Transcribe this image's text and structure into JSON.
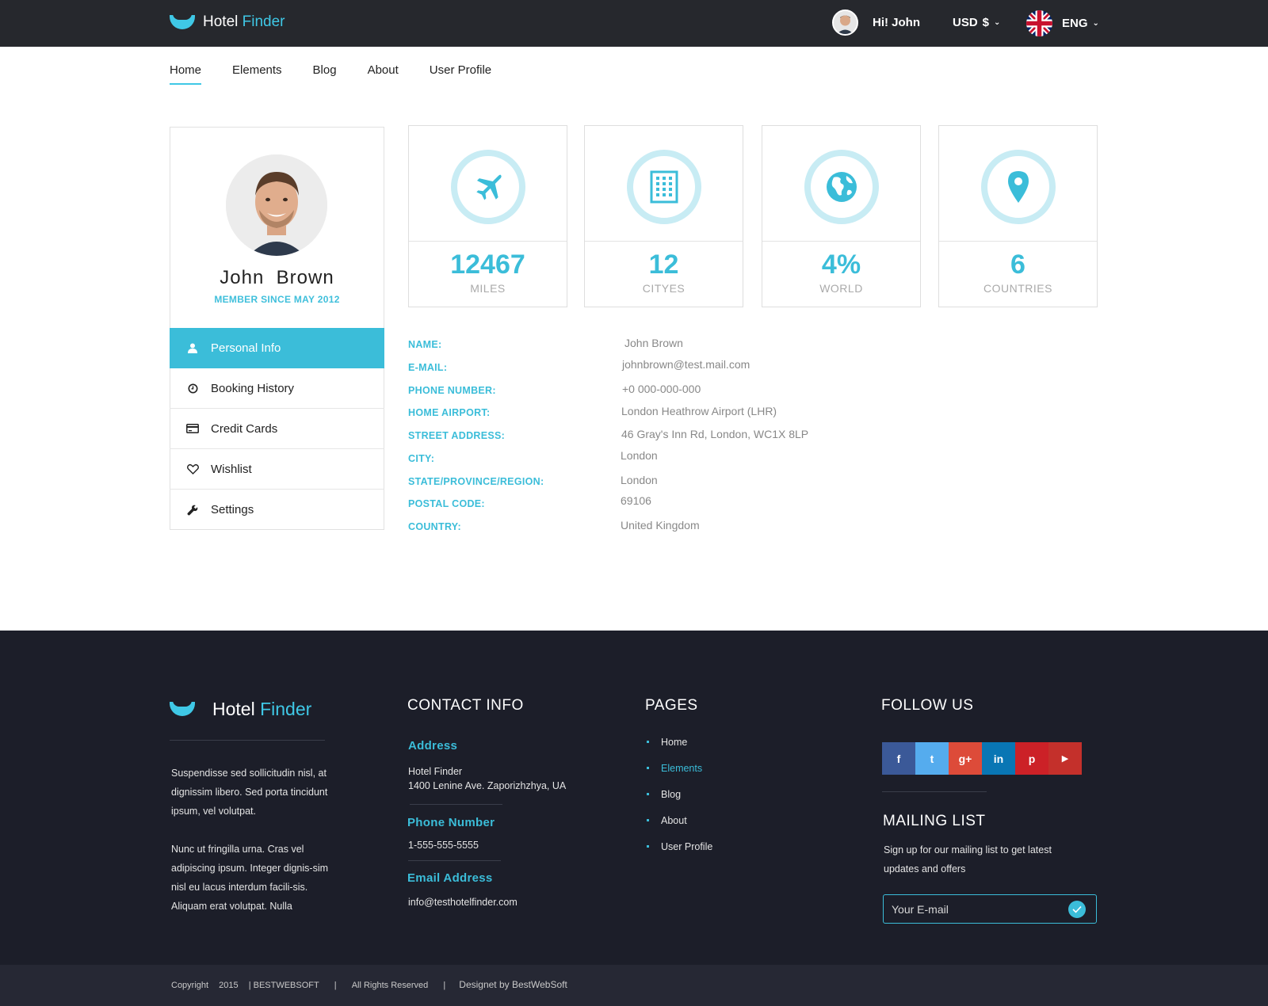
{
  "brand": {
    "name_part1": "Hotel",
    "name_part2": "Finder",
    "accent_color": "#3fc8e6"
  },
  "topbar": {
    "greeting": "Hi! John",
    "currency": "USD",
    "currency_symbol": "$",
    "language": "ENG",
    "flag_icon": "uk-flag-icon"
  },
  "nav": {
    "items": [
      {
        "label": "Home",
        "active": true
      },
      {
        "label": "Elements"
      },
      {
        "label": "Blog"
      },
      {
        "label": "About"
      },
      {
        "label": "User Profile"
      }
    ]
  },
  "profile": {
    "first_name": "John",
    "last_name": "Brown",
    "member_since": "MEMBER SINCE MAY 2012",
    "menu": [
      {
        "label": "Personal Info",
        "icon": "user-icon",
        "active": true
      },
      {
        "label": "Booking History",
        "icon": "clock-icon"
      },
      {
        "label": "Credit Cards",
        "icon": "credit-card-icon"
      },
      {
        "label": "Wishlist",
        "icon": "heart-icon"
      },
      {
        "label": "Settings",
        "icon": "wrench-icon"
      }
    ]
  },
  "stats": [
    {
      "value": "12467",
      "label": "MILES",
      "icon": "plane-icon"
    },
    {
      "value": "12",
      "label": "CITYES",
      "icon": "building-icon"
    },
    {
      "value": "4%",
      "label": "WORLD",
      "icon": "globe-icon"
    },
    {
      "value": "6",
      "label": "COUNTRIES",
      "icon": "map-pin-icon"
    }
  ],
  "personal_info": [
    {
      "label": "NAME:",
      "value": "John  Brown"
    },
    {
      "label": "E-MAIL:",
      "value": "johnbrown@test.mail.com"
    },
    {
      "label": "PHONE NUMBER:",
      "value": "+0 000-000-000"
    },
    {
      "label": "HOME AIRPORT:",
      "value": "London Heathrow Airport (LHR)"
    },
    {
      "label": "STREET ADDRESS:",
      "value": "46 Gray's Inn Rd, London, WC1X 8LP"
    },
    {
      "label": "CITY:",
      "value": "London"
    },
    {
      "label": "STATE/PROVINCE/REGION:",
      "value": "London"
    },
    {
      "label": "POSTAL CODE:",
      "value": "69106"
    },
    {
      "label": "COUNTRY:",
      "value": "United Kingdom"
    }
  ],
  "footer": {
    "about_p1": "Suspendisse sed sollicitudin nisl, at dignissim libero. Sed porta tincidunt ipsum, vel volutpat.",
    "about_p2": "Nunc ut fringilla urna. Cras vel adipiscing ipsum. Integer dignis-sim nisl eu lacus interdum facili-sis. Aliquam erat volutpat. Nulla",
    "contact": {
      "heading": "CONTACT INFO",
      "address_label": "Address",
      "address_line1": "Hotel Finder",
      "address_line2": "1400 Lenine Ave. Zaporizhzhya, UA",
      "phone_label": "Phone Number",
      "phone": "1-555-555-5555",
      "email_label": "Email Address",
      "email": "info@testhotelfinder.com"
    },
    "pages": {
      "heading": "PAGES",
      "items": [
        {
          "label": "Home"
        },
        {
          "label": "Elements",
          "active": true
        },
        {
          "label": "Blog"
        },
        {
          "label": "About"
        },
        {
          "label": "User Profile"
        }
      ]
    },
    "follow": {
      "heading": "FOLLOW US",
      "networks": [
        {
          "glyph": "f",
          "icon": "facebook-icon",
          "color": "#3b5998"
        },
        {
          "glyph": "t",
          "icon": "twitter-icon",
          "color": "#55acee"
        },
        {
          "glyph": "g+",
          "icon": "google-plus-icon",
          "color": "#dd4b39"
        },
        {
          "glyph": "in",
          "icon": "linkedin-icon",
          "color": "#0976b4"
        },
        {
          "glyph": "p",
          "icon": "pinterest-icon",
          "color": "#cc2127"
        },
        {
          "glyph": "▶",
          "icon": "youtube-icon",
          "color": "#c4302b"
        }
      ]
    },
    "mailing": {
      "heading": "MAILING LIST",
      "description": "Sign up for our mailing list to get latest updates and offers",
      "placeholder": "Your E-mail"
    },
    "copyright": {
      "part1": "Copyright",
      "year": "2015",
      "company": "| BESTWEBSOFT",
      "sep1": "|",
      "rights": "All Rights Reserved",
      "sep2": "|",
      "designer": "Designet by BestWebSoft"
    }
  }
}
